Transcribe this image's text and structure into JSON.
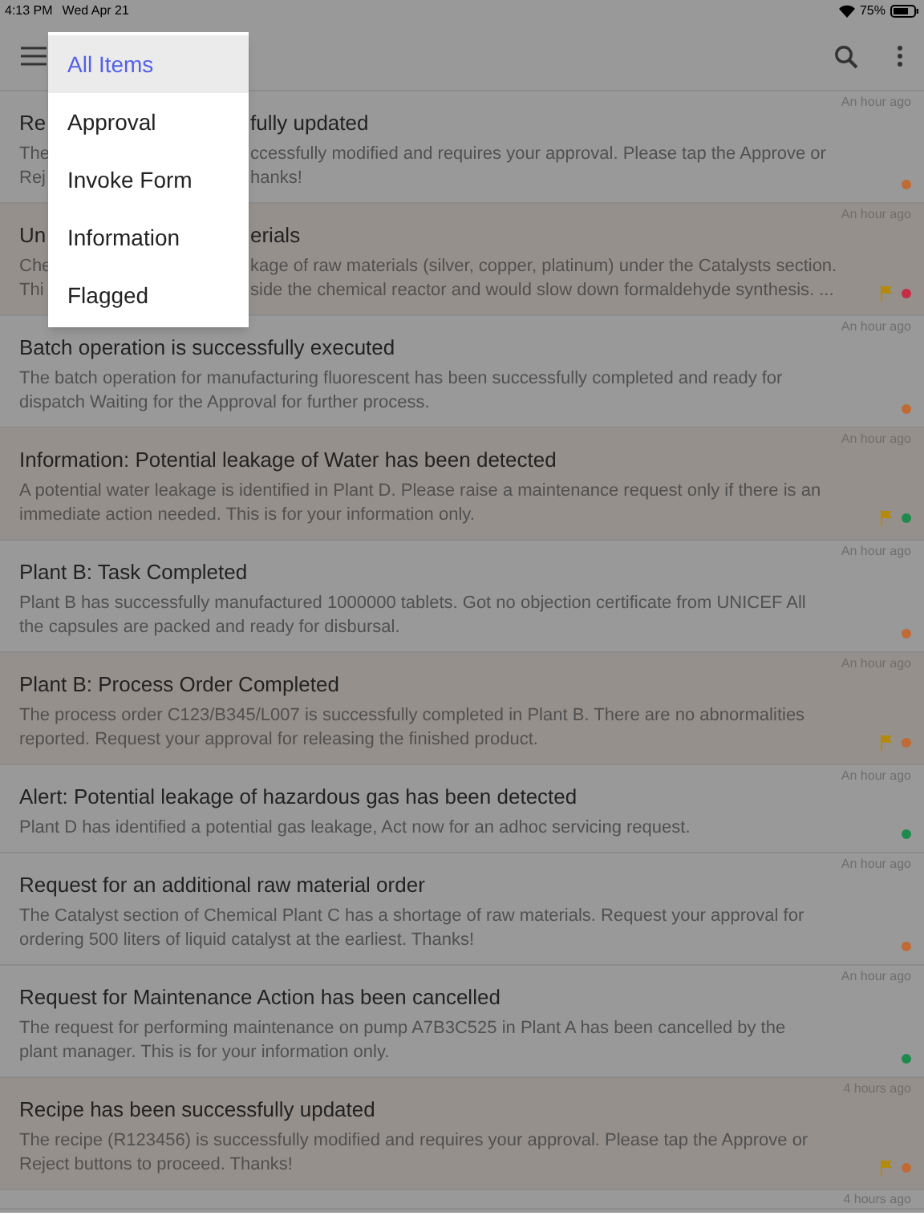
{
  "status_bar": {
    "time": "4:13 PM",
    "date": "Wed Apr 21",
    "battery": "75%"
  },
  "menu": {
    "items": [
      {
        "label": "All Items",
        "selected": true
      },
      {
        "label": "Approval",
        "selected": false
      },
      {
        "label": "Invoke Form",
        "selected": false
      },
      {
        "label": "Information",
        "selected": false
      },
      {
        "label": "Flagged",
        "selected": false
      }
    ]
  },
  "notifications": [
    {
      "time": "An hour ago",
      "title_parts": [
        "Re",
        "fully updated"
      ],
      "body_lines": [
        [
          "The",
          "ccessfully modified and requires your approval. Please tap the Approve or"
        ],
        [
          "Rej",
          "hanks!"
        ]
      ],
      "flagged": false,
      "color": "#c06a35"
    },
    {
      "time": "An hour ago",
      "title_parts": [
        "Un",
        "erials"
      ],
      "body_lines": [
        [
          "Che",
          "kage of raw materials (silver, copper, platinum) under the Catalysts section."
        ],
        [
          "Thi",
          "side the chemical reactor and would slow down formaldehyde synthesis. ..."
        ]
      ],
      "flagged": true,
      "color": "#c42d45"
    },
    {
      "time": "An hour ago",
      "title": "Batch operation is successfully executed",
      "body": "The batch operation for manufacturing fluorescent has been successfully completed and ready for dispatch Waiting for the Approval for further process.",
      "flagged": false,
      "color": "#c06a35"
    },
    {
      "time": "An hour ago",
      "title": "Information: Potential leakage of Water has been detected",
      "body": "A potential water leakage is identified in Plant D. Please raise a maintenance request only if there is an immediate action needed. This is for your information only.",
      "flagged": true,
      "color": "#1e8a4e"
    },
    {
      "time": "An hour ago",
      "title": "Plant B: Task Completed",
      "body": "Plant B has successfully manufactured 1000000 tablets. Got no objection certificate from UNICEF All the capsules are packed and ready for disbursal.",
      "flagged": false,
      "color": "#c06a35"
    },
    {
      "time": "An hour ago",
      "title": "Plant B: Process Order Completed",
      "body": "The process order C123/B345/L007 is successfully completed in Plant B. There are no abnormalities reported. Request your approval for releasing the finished product.",
      "flagged": true,
      "color": "#c06a35"
    },
    {
      "time": "An hour ago",
      "title": "Alert: Potential leakage of hazardous gas has been detected",
      "body": "Plant D has identified a potential gas leakage, Act now for an adhoc servicing request.",
      "flagged": false,
      "color": "#1e8a4e"
    },
    {
      "time": "An hour ago",
      "title": "Request for an additional raw material order",
      "body": "The Catalyst section of Chemical Plant C has a shortage of raw materials. Request your approval for ordering 500 liters of liquid catalyst at the earliest. Thanks!",
      "flagged": false,
      "color": "#c06a35"
    },
    {
      "time": "An hour ago",
      "title": "Request for Maintenance Action has been cancelled",
      "body": "The request for performing maintenance on pump A7B3C525 in Plant A has been cancelled by the plant manager. This is for your information only.",
      "flagged": false,
      "color": "#1e8a4e"
    },
    {
      "time": "4 hours ago",
      "title": "Recipe has been successfully updated",
      "body": "The recipe (R123456) is successfully modified and requires your approval. Please tap the Approve or Reject buttons to proceed. Thanks!",
      "flagged": true,
      "color": "#c06a35"
    },
    {
      "time": "4 hours ago",
      "flagged": false
    }
  ]
}
